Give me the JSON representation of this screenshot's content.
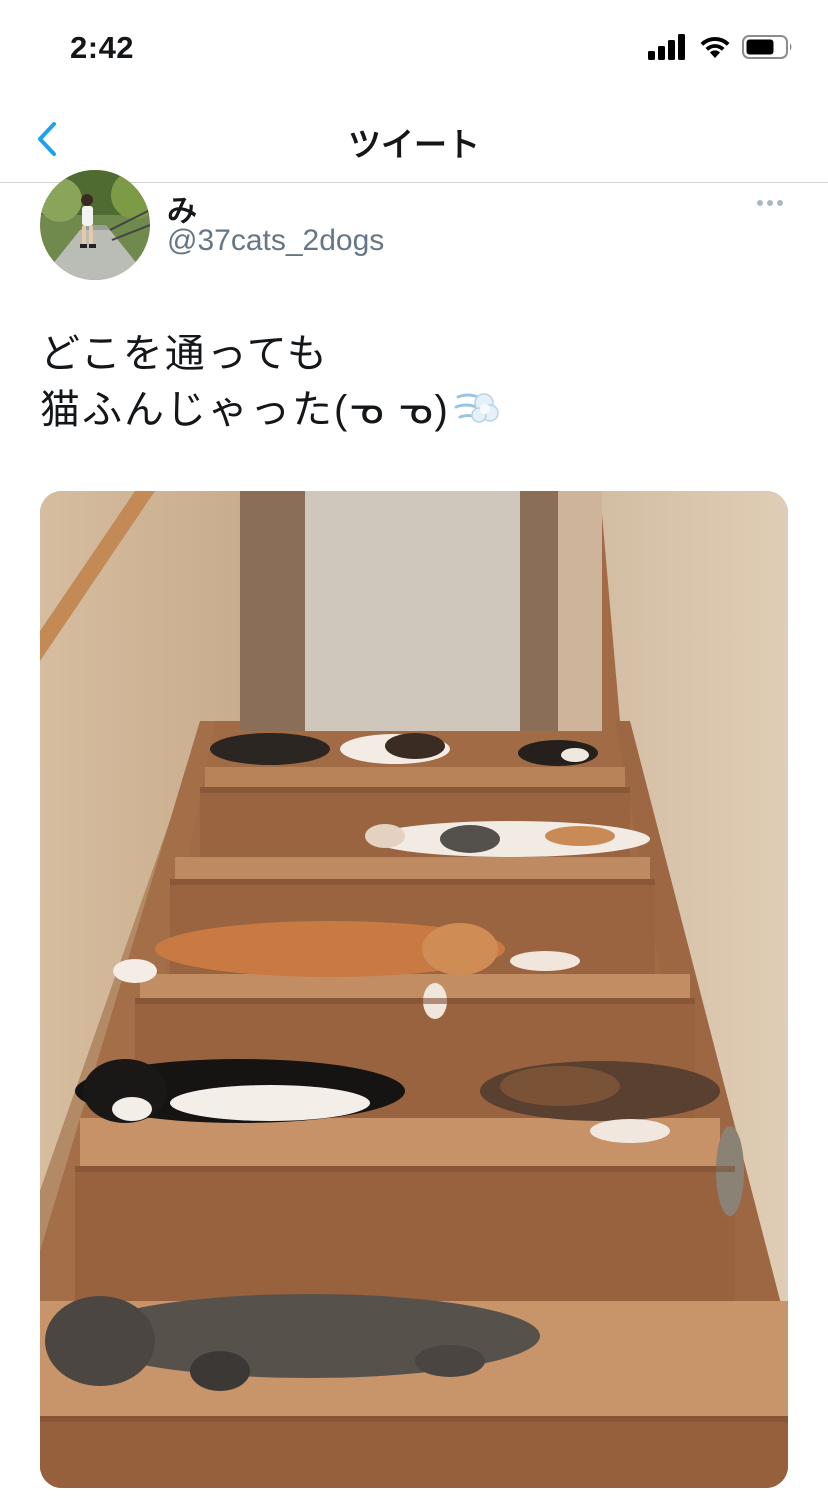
{
  "status_bar": {
    "time": "2:42",
    "signal_icon": "cellular-signal-icon",
    "wifi_icon": "wifi-icon",
    "battery_icon": "battery-icon"
  },
  "nav": {
    "title": "ツイート",
    "back_icon": "chevron-left-icon",
    "accent_color": "#1da1f2"
  },
  "tweet": {
    "author": {
      "display_name": "み",
      "handle": "@37cats_2dogs"
    },
    "more_icon": "ellipsis-icon",
    "text_lines": [
      "どこを通っても",
      "猫ふんじゃった(ᓀ ᓀ)"
    ],
    "trailing_emoji": "dash-emoji-icon",
    "media": {
      "description_icon": "photo-cats-on-stairs",
      "cats_per_step": [
        3,
        1,
        1,
        2,
        1
      ]
    }
  },
  "colors": {
    "handle_gray": "#657786",
    "divider": "#cfd4d8",
    "text": "#14171a"
  }
}
